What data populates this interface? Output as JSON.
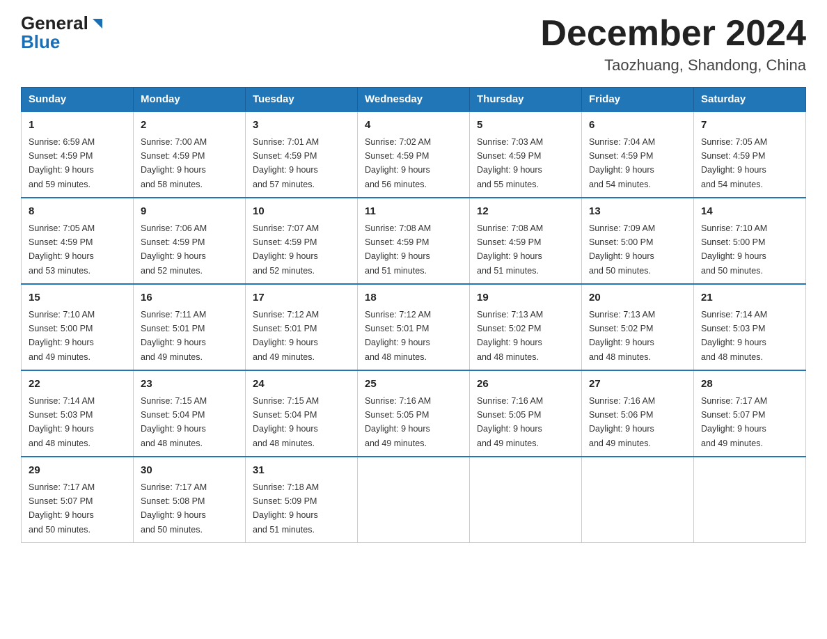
{
  "header": {
    "logo_general": "General",
    "logo_blue": "Blue",
    "title": "December 2024",
    "subtitle": "Taozhuang, Shandong, China"
  },
  "days_of_week": [
    "Sunday",
    "Monday",
    "Tuesday",
    "Wednesday",
    "Thursday",
    "Friday",
    "Saturday"
  ],
  "weeks": [
    [
      {
        "day": "1",
        "sunrise": "6:59 AM",
        "sunset": "4:59 PM",
        "daylight": "9 hours and 59 minutes."
      },
      {
        "day": "2",
        "sunrise": "7:00 AM",
        "sunset": "4:59 PM",
        "daylight": "9 hours and 58 minutes."
      },
      {
        "day": "3",
        "sunrise": "7:01 AM",
        "sunset": "4:59 PM",
        "daylight": "9 hours and 57 minutes."
      },
      {
        "day": "4",
        "sunrise": "7:02 AM",
        "sunset": "4:59 PM",
        "daylight": "9 hours and 56 minutes."
      },
      {
        "day": "5",
        "sunrise": "7:03 AM",
        "sunset": "4:59 PM",
        "daylight": "9 hours and 55 minutes."
      },
      {
        "day": "6",
        "sunrise": "7:04 AM",
        "sunset": "4:59 PM",
        "daylight": "9 hours and 54 minutes."
      },
      {
        "day": "7",
        "sunrise": "7:05 AM",
        "sunset": "4:59 PM",
        "daylight": "9 hours and 54 minutes."
      }
    ],
    [
      {
        "day": "8",
        "sunrise": "7:05 AM",
        "sunset": "4:59 PM",
        "daylight": "9 hours and 53 minutes."
      },
      {
        "day": "9",
        "sunrise": "7:06 AM",
        "sunset": "4:59 PM",
        "daylight": "9 hours and 52 minutes."
      },
      {
        "day": "10",
        "sunrise": "7:07 AM",
        "sunset": "4:59 PM",
        "daylight": "9 hours and 52 minutes."
      },
      {
        "day": "11",
        "sunrise": "7:08 AM",
        "sunset": "4:59 PM",
        "daylight": "9 hours and 51 minutes."
      },
      {
        "day": "12",
        "sunrise": "7:08 AM",
        "sunset": "4:59 PM",
        "daylight": "9 hours and 51 minutes."
      },
      {
        "day": "13",
        "sunrise": "7:09 AM",
        "sunset": "5:00 PM",
        "daylight": "9 hours and 50 minutes."
      },
      {
        "day": "14",
        "sunrise": "7:10 AM",
        "sunset": "5:00 PM",
        "daylight": "9 hours and 50 minutes."
      }
    ],
    [
      {
        "day": "15",
        "sunrise": "7:10 AM",
        "sunset": "5:00 PM",
        "daylight": "9 hours and 49 minutes."
      },
      {
        "day": "16",
        "sunrise": "7:11 AM",
        "sunset": "5:01 PM",
        "daylight": "9 hours and 49 minutes."
      },
      {
        "day": "17",
        "sunrise": "7:12 AM",
        "sunset": "5:01 PM",
        "daylight": "9 hours and 49 minutes."
      },
      {
        "day": "18",
        "sunrise": "7:12 AM",
        "sunset": "5:01 PM",
        "daylight": "9 hours and 48 minutes."
      },
      {
        "day": "19",
        "sunrise": "7:13 AM",
        "sunset": "5:02 PM",
        "daylight": "9 hours and 48 minutes."
      },
      {
        "day": "20",
        "sunrise": "7:13 AM",
        "sunset": "5:02 PM",
        "daylight": "9 hours and 48 minutes."
      },
      {
        "day": "21",
        "sunrise": "7:14 AM",
        "sunset": "5:03 PM",
        "daylight": "9 hours and 48 minutes."
      }
    ],
    [
      {
        "day": "22",
        "sunrise": "7:14 AM",
        "sunset": "5:03 PM",
        "daylight": "9 hours and 48 minutes."
      },
      {
        "day": "23",
        "sunrise": "7:15 AM",
        "sunset": "5:04 PM",
        "daylight": "9 hours and 48 minutes."
      },
      {
        "day": "24",
        "sunrise": "7:15 AM",
        "sunset": "5:04 PM",
        "daylight": "9 hours and 48 minutes."
      },
      {
        "day": "25",
        "sunrise": "7:16 AM",
        "sunset": "5:05 PM",
        "daylight": "9 hours and 49 minutes."
      },
      {
        "day": "26",
        "sunrise": "7:16 AM",
        "sunset": "5:05 PM",
        "daylight": "9 hours and 49 minutes."
      },
      {
        "day": "27",
        "sunrise": "7:16 AM",
        "sunset": "5:06 PM",
        "daylight": "9 hours and 49 minutes."
      },
      {
        "day": "28",
        "sunrise": "7:17 AM",
        "sunset": "5:07 PM",
        "daylight": "9 hours and 49 minutes."
      }
    ],
    [
      {
        "day": "29",
        "sunrise": "7:17 AM",
        "sunset": "5:07 PM",
        "daylight": "9 hours and 50 minutes."
      },
      {
        "day": "30",
        "sunrise": "7:17 AM",
        "sunset": "5:08 PM",
        "daylight": "9 hours and 50 minutes."
      },
      {
        "day": "31",
        "sunrise": "7:18 AM",
        "sunset": "5:09 PM",
        "daylight": "9 hours and 51 minutes."
      },
      null,
      null,
      null,
      null
    ]
  ],
  "labels": {
    "sunrise": "Sunrise: ",
    "sunset": "Sunset: ",
    "daylight": "Daylight: "
  }
}
